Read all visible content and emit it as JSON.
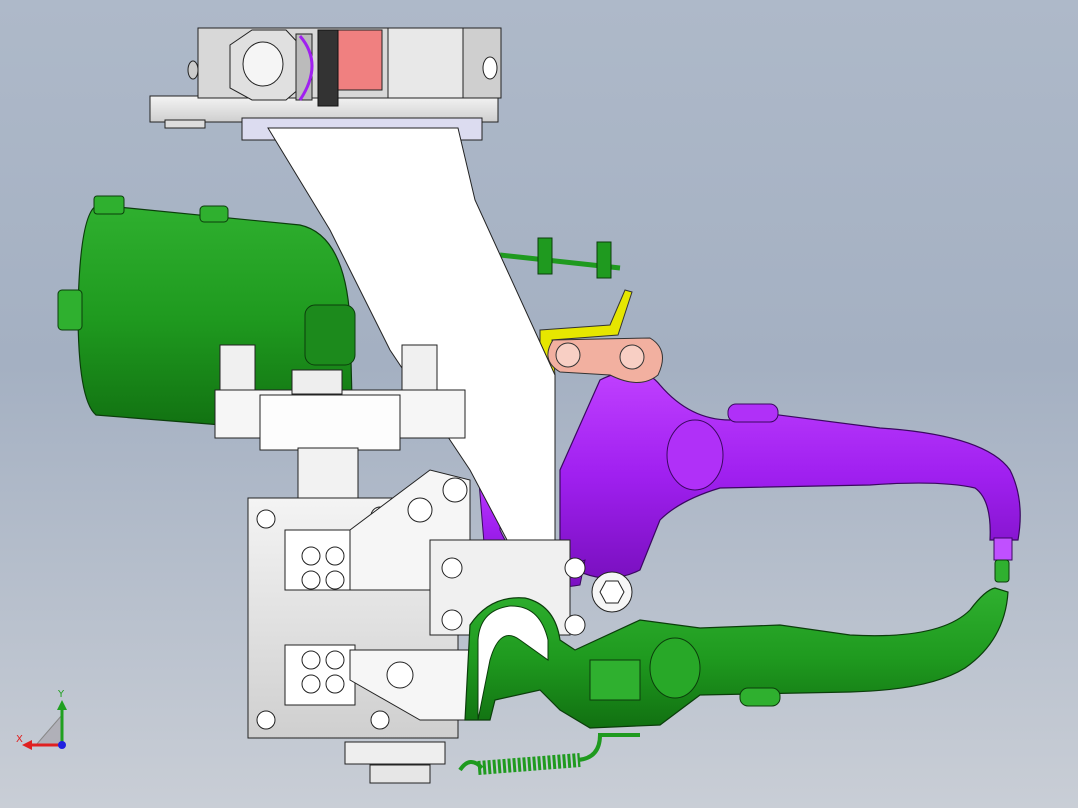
{
  "viewport": {
    "background_top": "#aeb9c9",
    "background_bottom": "#c9ced6"
  },
  "parts": {
    "transformer": {
      "color": "#1f9a1f"
    },
    "upper_arm": {
      "color": "#a020f0"
    },
    "lower_arm": {
      "color": "#1f9a1f"
    },
    "link_plate": {
      "color": "#f2b0a0"
    },
    "bracket": {
      "color": "#e6e600"
    },
    "cylinder_block_accent": {
      "color": "#f08080"
    }
  },
  "triad": {
    "x_label": "X",
    "y_label": "Y",
    "x_color": "#e02020",
    "y_color": "#20a020",
    "z_color": "#2020e0"
  }
}
